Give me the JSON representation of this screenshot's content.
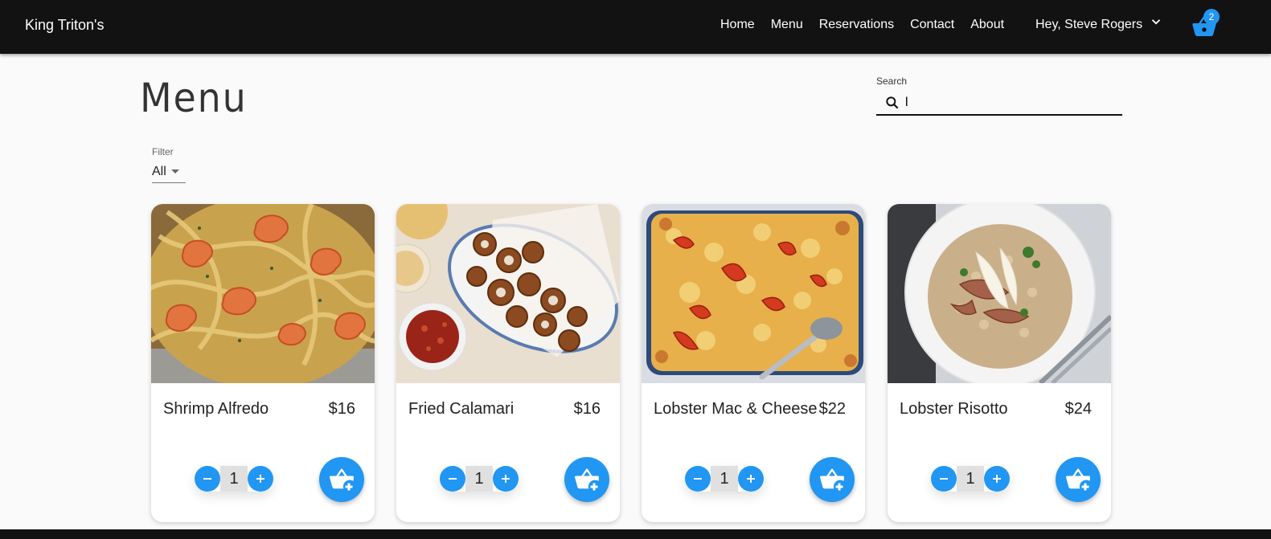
{
  "header": {
    "brand": "King Triton's",
    "nav": [
      "Home",
      "Menu",
      "Reservations",
      "Contact",
      "About"
    ],
    "user_greeting": "Hey, Steve Rogers",
    "cart_count": "2"
  },
  "page": {
    "title": "Menu",
    "search": {
      "label": "Search",
      "value": "l"
    },
    "filter": {
      "label": "Filter",
      "value": "All"
    }
  },
  "menu_items": [
    {
      "name": "Shrimp Alfredo",
      "price": "$16",
      "quantity": "1"
    },
    {
      "name": "Fried Calamari",
      "price": "$16",
      "quantity": "1"
    },
    {
      "name": "Lobster Mac & Cheese",
      "price": "$22",
      "quantity": "1"
    },
    {
      "name": "Lobster Risotto",
      "price": "$24",
      "quantity": "1"
    }
  ],
  "colors": {
    "accent": "#2196f3",
    "header_bg": "#121212",
    "page_bg": "#fafafa"
  }
}
